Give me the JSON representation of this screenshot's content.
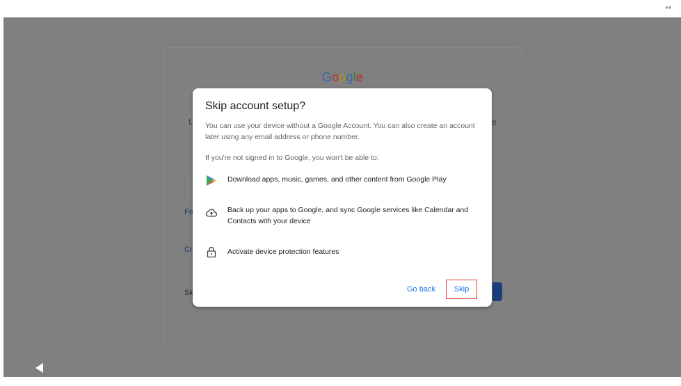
{
  "window": {
    "expand_icon": "↔"
  },
  "background": {
    "logo": [
      "G",
      "o",
      "o",
      "g",
      "l",
      "e"
    ],
    "logo_colors": [
      "#3a68b0",
      "#b0362c",
      "#b8920f",
      "#3a68b0",
      "#2f8040",
      "#b0362c"
    ],
    "partial_left": "U",
    "partial_right": "e",
    "link_forgot_partial": "Fo",
    "link_create_partial": "Cr",
    "skip_partial": "Sk"
  },
  "dialog": {
    "title": "Skip account setup?",
    "body": "You can use your device without a Google Account. You can also create an account later using any email address or phone number.",
    "subtitle": "If you're not signed in to Google, you won't be able to:",
    "items": [
      {
        "icon": "google-play-icon",
        "text": "Download apps, music, games, and other content from Google Play"
      },
      {
        "icon": "cloud-upload-icon",
        "text": "Back up your apps to Google, and sync Google services like Calendar and Contacts with your device"
      },
      {
        "icon": "lock-icon",
        "text": "Activate device protection features"
      }
    ],
    "go_back_label": "Go back",
    "skip_label": "Skip"
  },
  "colors": {
    "accent": "#1a73e8",
    "highlight": "#e53935",
    "overlay": "#808080"
  }
}
